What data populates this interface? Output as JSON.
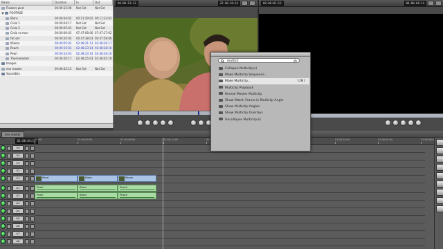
{
  "browser": {
    "columns": [
      "Name",
      "Duration",
      "In",
      "Out"
    ],
    "rows": [
      {
        "name": "Flowers pied",
        "dur": "00:00:15:06",
        "in": "Not Set",
        "out": "Not Set",
        "indent": 0,
        "blue": false,
        "folder": false,
        "twisty": false
      },
      {
        "name": "FOOTAGE",
        "dur": "",
        "in": "",
        "out": "",
        "indent": 0,
        "blue": false,
        "folder": true,
        "twisty": true
      },
      {
        "name": "Blanc",
        "dur": "00:00:04:02",
        "in": "00:11:29:02",
        "out": "00:11:33:03",
        "indent": 1,
        "blue": false,
        "folder": false,
        "twisty": false
      },
      {
        "name": "Croiz 1",
        "dur": "00:00:04:17",
        "in": "Not Set",
        "out": "Not Set",
        "indent": 1,
        "blue": false,
        "folder": false,
        "twisty": false
      },
      {
        "name": "Croiz 2",
        "dur": "00:00:05:03",
        "in": "Not Set",
        "out": "Not Set",
        "indent": 1,
        "blue": false,
        "folder": false,
        "twisty": false
      },
      {
        "name": "Croiz vs man",
        "dur": "00:00:00:03",
        "in": "07:47:08:00",
        "out": "07:47:17:02",
        "indent": 1,
        "blue": false,
        "folder": false,
        "twisty": false
      },
      {
        "name": "Fat set",
        "dur": "00:00:20:04",
        "in": "00:47:38:03",
        "out": "00:47:58:06",
        "indent": 1,
        "blue": false,
        "folder": false,
        "twisty": false
      },
      {
        "name": "Mixmo",
        "dur": "00:00:05:03",
        "in": "02:48:21:13",
        "out": "02:48:26:17",
        "indent": 1,
        "blue": true,
        "folder": false,
        "twisty": false
      },
      {
        "name": "Peach",
        "dur": "00:00:15:03",
        "in": "02:48:23:14",
        "out": "02:48:28:16",
        "indent": 1,
        "blue": true,
        "folder": false,
        "twisty": false
      },
      {
        "name": "Pearl",
        "dur": "00:00:14:03",
        "in": "02:48:23:14",
        "out": "02:48:28:16",
        "indent": 1,
        "blue": true,
        "folder": false,
        "twisty": false
      },
      {
        "name": "Thermometer",
        "dur": "00:00:20:17",
        "in": "02:48:25:03",
        "out": "02:48:45:19",
        "indent": 1,
        "blue": false,
        "folder": false,
        "twisty": false
      },
      {
        "name": "Images",
        "dur": "",
        "in": "",
        "out": "",
        "indent": 0,
        "blue": false,
        "folder": true,
        "twisty": false
      },
      {
        "name": "env master",
        "dur": "00:00:42:13",
        "in": "Not Set",
        "out": "Not Set",
        "indent": 0,
        "blue": false,
        "folder": false,
        "twisty": false
      },
      {
        "name": "Soundbits",
        "dur": "",
        "in": "",
        "out": "",
        "indent": 0,
        "blue": false,
        "folder": true,
        "twisty": false
      }
    ]
  },
  "viewer": {
    "tc_left": "00:00:13:13",
    "tc_right": "22:46:28:14"
  },
  "canvas": {
    "tc_left": "00:00:02:12",
    "tc_right": "00:00:04:14"
  },
  "palette": {
    "search_value": "multicli",
    "items": [
      {
        "label": "Collapse Multiclip(s)",
        "shortcut": "",
        "selected": false
      },
      {
        "label": "Make Multiclip Sequence...",
        "shortcut": "",
        "selected": false
      },
      {
        "label": "Make Multiclip...",
        "shortcut": "⌥⌘⇧",
        "selected": true
      },
      {
        "label": "Multiclip Playback",
        "shortcut": "",
        "selected": false
      },
      {
        "label": "Reveal Master Multiclip",
        "shortcut": "",
        "selected": false
      },
      {
        "label": "Show Match Frame in Multiclip Angle",
        "shortcut": "",
        "selected": false
      },
      {
        "label": "Show Multiclip Angles",
        "shortcut": "",
        "selected": false
      },
      {
        "label": "Show Multiclip Overlays",
        "shortcut": "",
        "selected": false
      },
      {
        "label": "Uncollapse Multiclip(s)",
        "shortcut": "",
        "selected": false
      }
    ]
  },
  "timeline": {
    "tab_label": "env master",
    "playhead_tc": "01:00:04:14",
    "ruler_labels": [
      "00:00",
      "01:00:04:00",
      "01:00:08:00",
      "01:00:12:00",
      "01:00:16:00",
      "01:00:20:00",
      "01:00:24:00",
      "01:00:28:00",
      "01:00:32:00",
      "01:00:36:00"
    ],
    "video_tracks": [
      "V5",
      "V4",
      "V3",
      "V2",
      "V1"
    ],
    "audio_tracks": [
      "A1",
      "A2",
      "A3",
      "A4",
      "A5",
      "A6",
      "A7",
      "A8"
    ],
    "video_clips": [
      "Pearl",
      "Blanc",
      "Peach"
    ],
    "audio_clips_a1": [
      "Pearl",
      "Blanc",
      "Peach"
    ],
    "audio_clips_a2": [
      "Pearl",
      "Blanc",
      "Peach"
    ]
  }
}
